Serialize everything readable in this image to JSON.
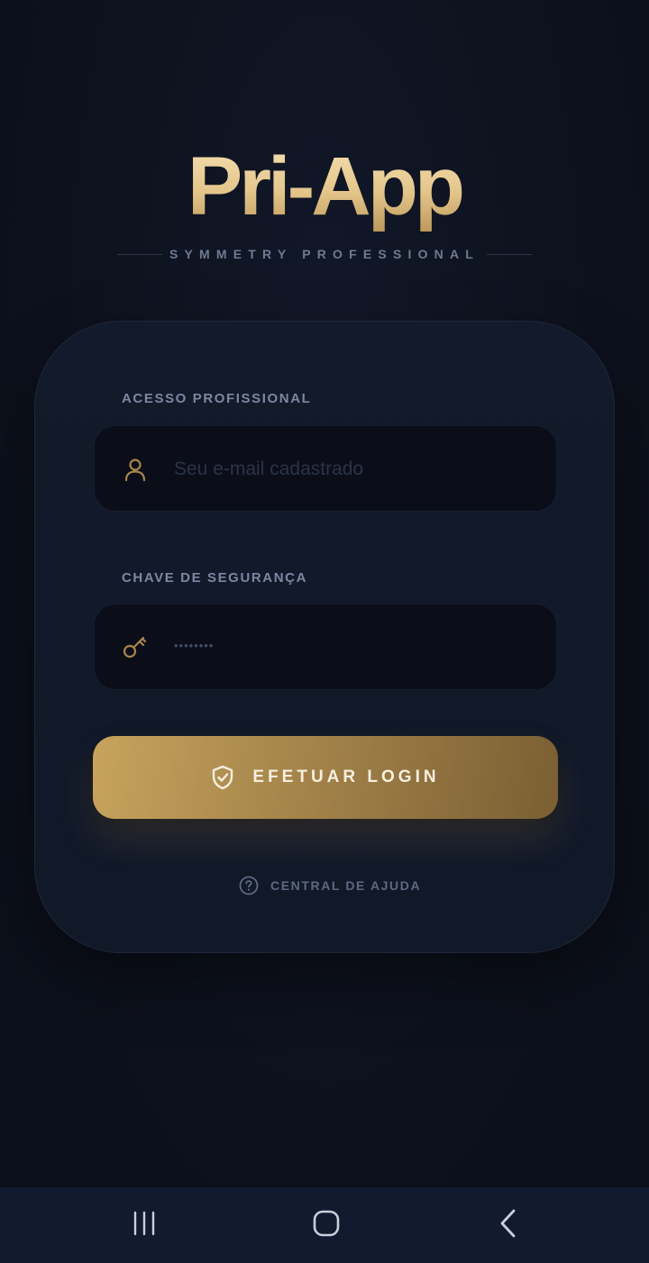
{
  "brand": {
    "title": "Pri-App",
    "subtitle": "SYMMETRY PROFESSIONAL"
  },
  "login": {
    "email_label": "ACESSO PROFISSIONAL",
    "email_placeholder": "Seu e-mail cadastrado",
    "email_icon": "user-icon",
    "password_label": "CHAVE DE SEGURANÇA",
    "password_value": "••••••••",
    "password_icon": "key-icon",
    "submit_label": "EFETUAR LOGIN",
    "submit_icon": "shield-check-icon",
    "help_label": "CENTRAL DE AJUDA",
    "help_icon": "question-circle-icon"
  },
  "navbar": {
    "items": [
      "recent-apps-icon",
      "home-icon",
      "back-icon"
    ]
  },
  "colors": {
    "background": "#0d111c",
    "card": "#121a2b",
    "accent_gold": "#c7a35d",
    "muted_text": "#7c88a2"
  }
}
